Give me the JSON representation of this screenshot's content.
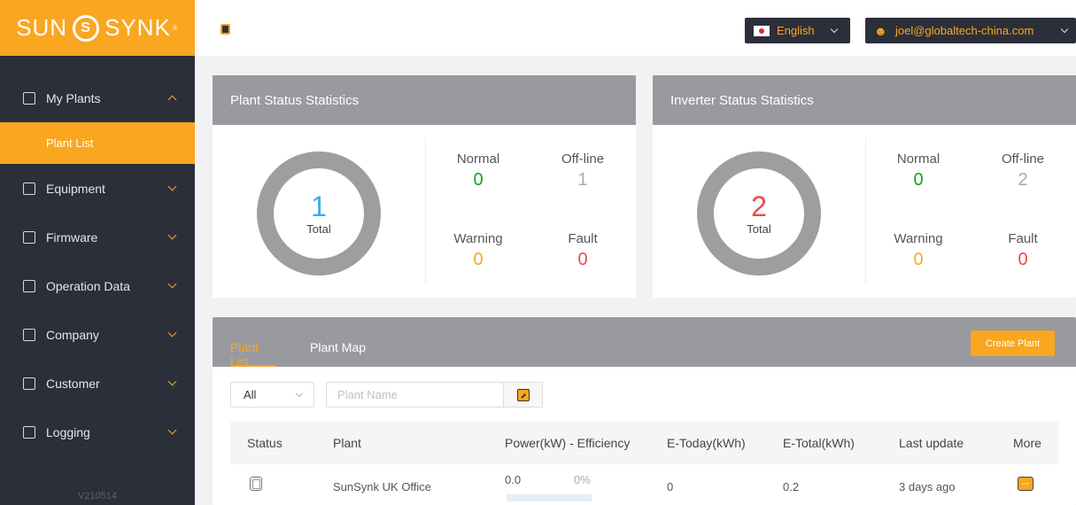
{
  "brand": {
    "logo_text_left": "SUN",
    "logo_text_right": "SYNK",
    "logo_mark": "S",
    "reg": "®"
  },
  "sidebar": {
    "items": [
      {
        "label": "My Plants",
        "icon": "home-icon",
        "expanded": true
      },
      {
        "label": "Equipment",
        "icon": "monitor-icon"
      },
      {
        "label": "Firmware",
        "icon": "upload-icon"
      },
      {
        "label": "Operation Data",
        "icon": "calendar-icon"
      },
      {
        "label": "Company",
        "icon": "building-icon"
      },
      {
        "label": "Customer",
        "icon": "users-icon"
      },
      {
        "label": "Logging",
        "icon": "log-icon"
      }
    ],
    "sub_items": [
      {
        "label": "Plant List",
        "active": true
      }
    ],
    "version": "V210514"
  },
  "topbar": {
    "language": "English",
    "user_email": "joel@globaltech-china.com"
  },
  "plant_status": {
    "title": "Plant Status Statistics",
    "total_value": "1",
    "total_label": "Total",
    "normal_label": "Normal",
    "normal_value": "0",
    "offline_label": "Off-line",
    "offline_value": "1",
    "warning_label": "Warning",
    "warning_value": "0",
    "fault_label": "Fault",
    "fault_value": "0"
  },
  "inverter_status": {
    "title": "Inverter Status Statistics",
    "total_value": "2",
    "total_label": "Total",
    "normal_label": "Normal",
    "normal_value": "0",
    "offline_label": "Off-line",
    "offline_value": "2",
    "warning_label": "Warning",
    "warning_value": "0",
    "fault_label": "Fault",
    "fault_value": "0"
  },
  "plant_list": {
    "tabs": [
      {
        "label": "Plant List",
        "active": true
      },
      {
        "label": "Plant Map",
        "active": false
      }
    ],
    "create_label": "Create Plant",
    "filter_value": "All",
    "search_placeholder": "Plant Name",
    "columns": [
      "Status",
      "Plant",
      "Power(kW) - Efficiency",
      "E-Today(kWh)",
      "E-Total(kWh)",
      "Last update",
      "More"
    ],
    "rows": [
      {
        "plant": "SunSynk UK Office",
        "power": "0.0",
        "efficiency": "0%",
        "efficiency_fraction": 0,
        "e_today": "0",
        "e_total": "0.2",
        "last_update": "3 days ago"
      }
    ]
  },
  "colors": {
    "accent": "#f9a621",
    "sidebar": "#2b2f3a",
    "card_header": "#999aa0",
    "green": "#19a319",
    "red": "#e84a4a",
    "blue": "#3aaee8"
  }
}
